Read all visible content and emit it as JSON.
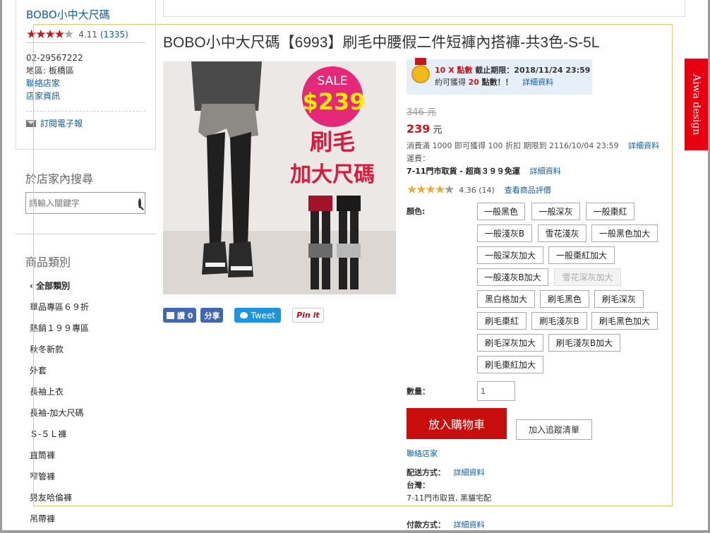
{
  "store": {
    "name": "BOBO小中大尺碼",
    "score": "4.11",
    "count": "(1335)",
    "phone": "02-29567222",
    "area": "地區: 板橋區",
    "contact": "聯絡店家",
    "info": "店家資訊",
    "subscribe": "訂閱電子報"
  },
  "search": {
    "title": "於店家內搜尋",
    "placeholder": "請輸入關鍵字"
  },
  "categories": {
    "title": "商品類別",
    "items": [
      "‹ 全部類別",
      "單品專區６９折",
      "熱銷１９９專區",
      "秋冬新款",
      "外套",
      "長袖上衣",
      "長袖-加大尺碼",
      "Ｓ-５Ｌ褲",
      "直筒褲",
      "窄管褲",
      "男友哈倫褲",
      "吊帶褲"
    ]
  },
  "product": {
    "title": "BOBO小中大尺碼【6993】刷毛中腰假二件短褲內搭褲-共3色-S-5L",
    "image": {
      "sale": "SALE",
      "price": "$239",
      "line1": "刷毛",
      "line2": "加大尺碼"
    }
  },
  "share": {
    "like": "讚 0",
    "share": "分享",
    "tweet": "Tweet",
    "pin": "Pin it"
  },
  "points": {
    "times": "10 X 點數",
    "deadline_label": " 截止期限：",
    "deadline": "2018/11/24 23:59",
    "earn_prefix": "約可獲得 ",
    "earn_num": "20",
    "earn_suffix": " 點數！！",
    "detail": "詳細資料"
  },
  "price": {
    "original": "346 元",
    "current": "239",
    "unit": " 元"
  },
  "discount": {
    "text": "消費滿 1000 即可獲得 100 折扣 期限到 2116/10/04 23:59",
    "detail": "詳細資料"
  },
  "shipping_fee": {
    "label": "運費：",
    "text": "7-11門市取貨 - 超商３９９免運",
    "detail": "詳細資料"
  },
  "review": {
    "score": "4.36 (14)",
    "link": "查看商品評價"
  },
  "colors": {
    "label": "顏色:",
    "options": [
      "一般黑色",
      "一般深灰",
      "一般棗紅",
      "一般淺灰B",
      "雪花淺灰",
      "一般黑色加大",
      "一般深灰加大",
      "一般棗紅加大",
      "一般淺灰B加大",
      "雪花深灰加大",
      "黑白格加大",
      "刷毛黑色",
      "刷毛深灰",
      "刷毛棗紅",
      "刷毛淺灰B",
      "刷毛黑色加大",
      "刷毛深灰加大",
      "刷毛淺灰B加大",
      "刷毛棗紅加大"
    ]
  },
  "quantity": {
    "label": "數量：",
    "value": "1"
  },
  "actions": {
    "add_to_cart": "放入購物車",
    "track": "加入追蹤清單",
    "contact": "聯絡店家"
  },
  "delivery": {
    "label": "配送方式：",
    "detail": "詳細資料",
    "region": "台灣：",
    "methods": "7-11門市取貨, 黑貓宅配"
  },
  "payment": {
    "label": "付款方式：",
    "detail": "詳細資料"
  },
  "side_tab": "Aiwa design",
  "theme": {
    "accent_red": "#c80d0d",
    "link_blue": "#0b5ea8",
    "star_red": "#c8161d",
    "star_orange": "#f2a93b",
    "overlay_orange": "#f5c36b"
  }
}
